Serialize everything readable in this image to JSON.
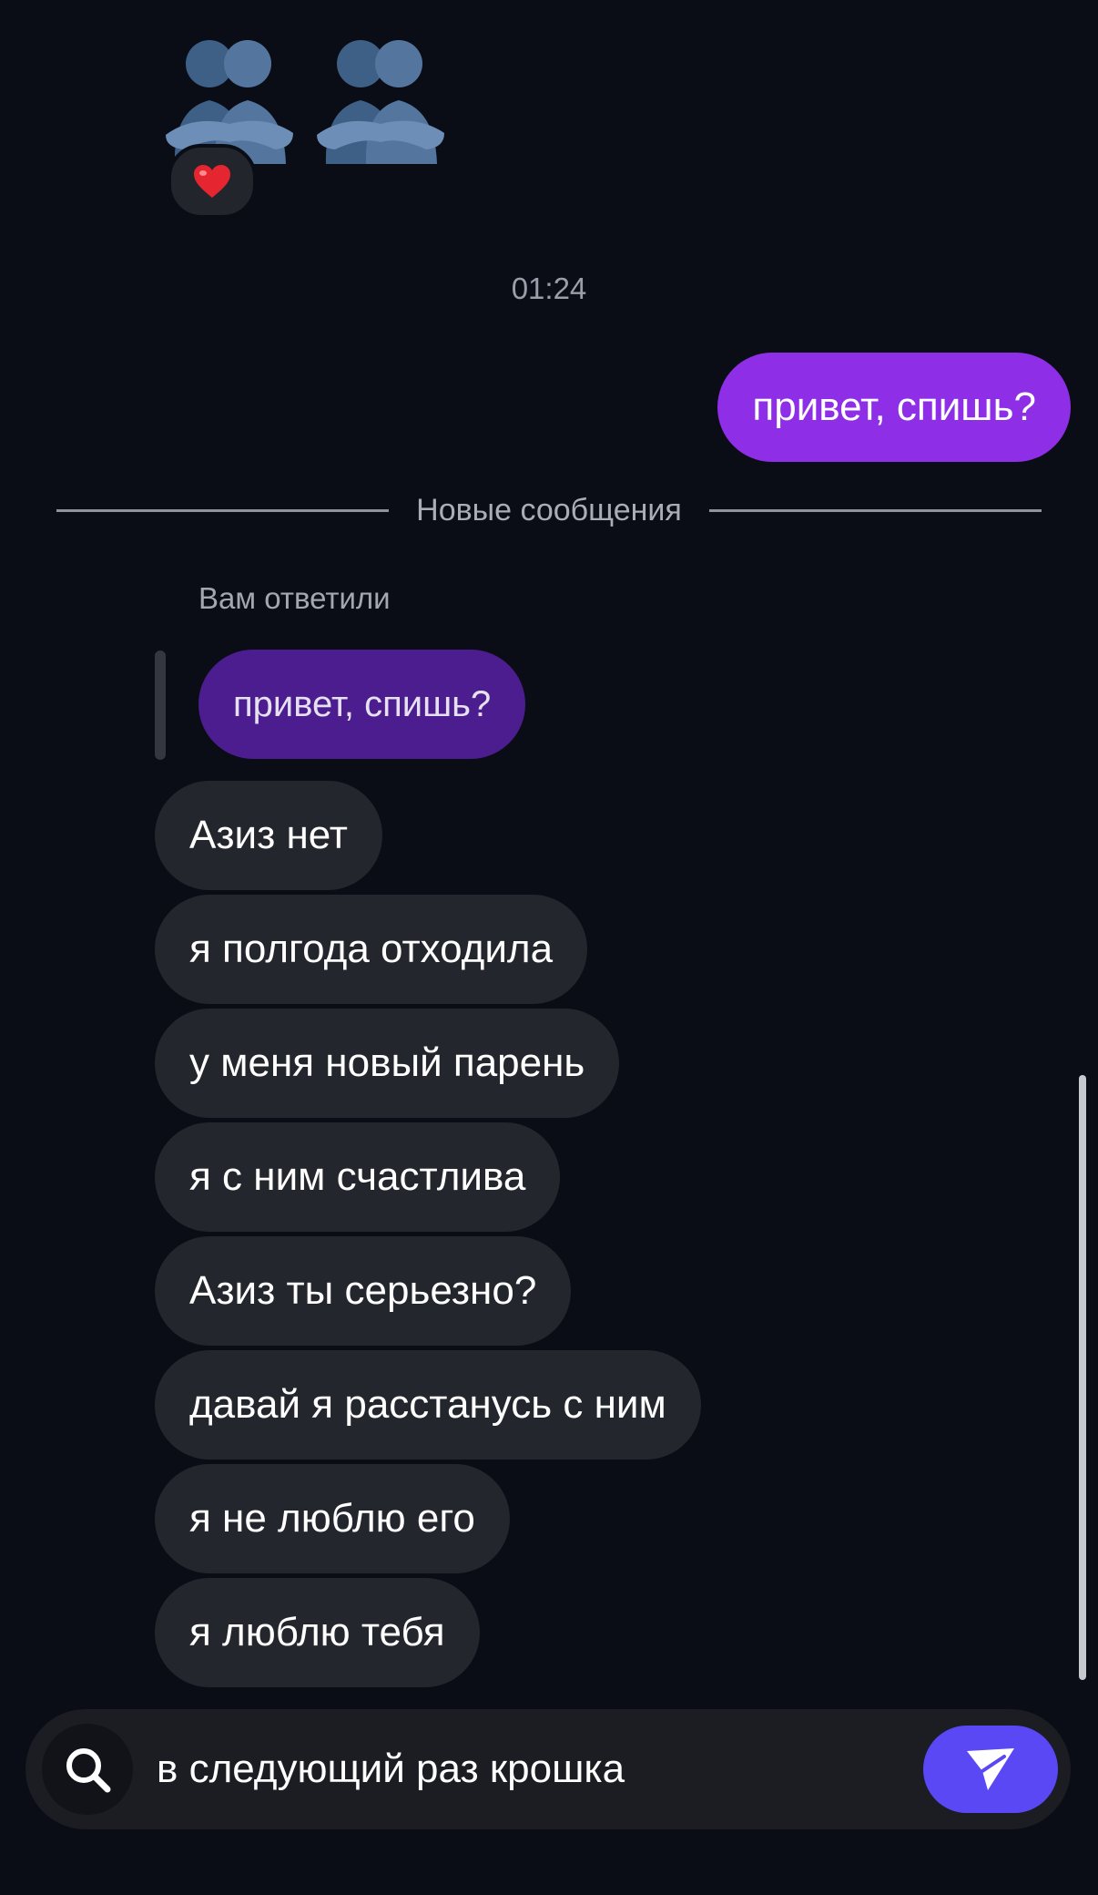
{
  "top": {
    "emojis": [
      "people-hugging-icon",
      "people-hugging-icon"
    ],
    "reaction": "heart-icon"
  },
  "timestamp": "01:24",
  "outgoing": {
    "text": "привет, спишь?",
    "color": "#8e2ee6"
  },
  "divider": {
    "label": "Новые сообщения"
  },
  "reply": {
    "label": "Вам ответили",
    "quoted_text": "привет, спишь?"
  },
  "incoming": [
    "Азиз нет",
    "я полгода отходила",
    "у меня новый парень",
    "я с ним счастлива",
    "Азиз ты серьезно?",
    "давай я расстанусь с ним",
    "я не люблю его",
    "я люблю тебя"
  ],
  "composer": {
    "text": "в следующий раз крошка",
    "search_icon": "search-icon",
    "send_icon": "send-icon",
    "send_color": "#5a48f5"
  }
}
